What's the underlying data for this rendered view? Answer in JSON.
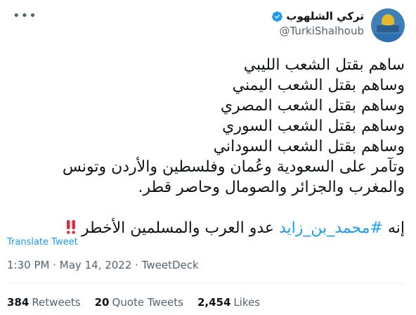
{
  "author": {
    "display_name": "تركي الشلهوب",
    "handle": "@TurkiShalhoub",
    "verified": true
  },
  "tweet": {
    "lines": [
      "ساهم بقتل الشعب الليبي",
      "وساهم بقتل الشعب اليمني",
      "وساهم بقتل الشعب المصري",
      "وساهم بقتل الشعب السوري",
      "وساهم بقتل الشعب السوداني",
      "وتآمر على السعودية وعُمان وفلسطين والأردن وتونس",
      "والمغرب والجزائر والصومال وحاصر قطر."
    ],
    "last_line": {
      "prefix": "إنه ",
      "hashtag": "#محمد_بن_زايد",
      "suffix": " عدو العرب والمسلمين الأخطر",
      "emoji": "double-exclamation-icon"
    }
  },
  "translate_label": "Translate Tweet",
  "meta": {
    "time": "1:30 PM",
    "date": "May 14, 2022",
    "source": "TweetDeck",
    "separator": "·"
  },
  "stats": {
    "retweets_count": "384",
    "retweets_label": "Retweets",
    "quotes_count": "20",
    "quotes_label": "Quote Tweets",
    "likes_count": "2,454",
    "likes_label": "Likes"
  },
  "colors": {
    "link": "#1d9bf0",
    "muted": "#536471",
    "text": "#0f1419"
  }
}
